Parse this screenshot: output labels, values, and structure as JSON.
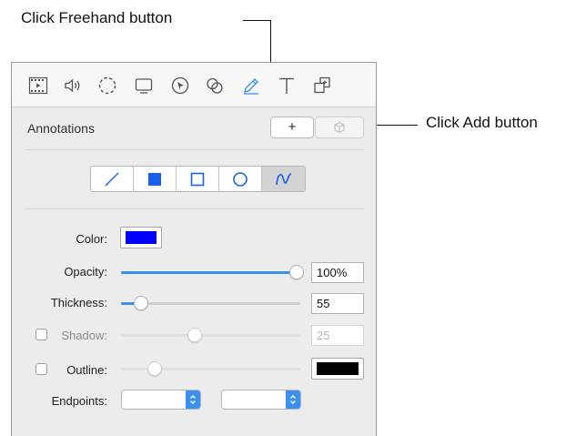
{
  "callouts": {
    "freehand": "Click Freehand button",
    "add": "Click Add button"
  },
  "toolbar": {
    "icons": [
      "film-icon",
      "speaker-icon",
      "dashed-circle-icon",
      "monitor-icon",
      "pointer-icon",
      "overlap-circles-icon",
      "pencil-icon",
      "text-icon",
      "stack-icon"
    ],
    "active_icon": "pencil-icon",
    "accent_color": "#3b8ff0"
  },
  "annotations": {
    "title": "Annotations",
    "add_label": "+",
    "shape_tools": [
      "line-tool",
      "filled-rectangle-tool",
      "rectangle-tool",
      "circle-tool",
      "freehand-tool"
    ],
    "selected_tool": "freehand-tool"
  },
  "properties": {
    "color_label": "Color:",
    "color_value": "#0000ff",
    "opacity_label": "Opacity:",
    "opacity_value": "100%",
    "opacity_level": 1.0,
    "thickness_label": "Thickness:",
    "thickness_value": "55",
    "thickness_level": 0.11,
    "shadow_label": "Shadow:",
    "shadow_checked": false,
    "shadow_value": "25",
    "shadow_level": 0.41,
    "outline_label": "Outline:",
    "outline_checked": false,
    "outline_level": 0.19,
    "outline_color": "#000000",
    "endpoints_label": "Endpoints:",
    "endpoint_start": "",
    "endpoint_end": ""
  }
}
